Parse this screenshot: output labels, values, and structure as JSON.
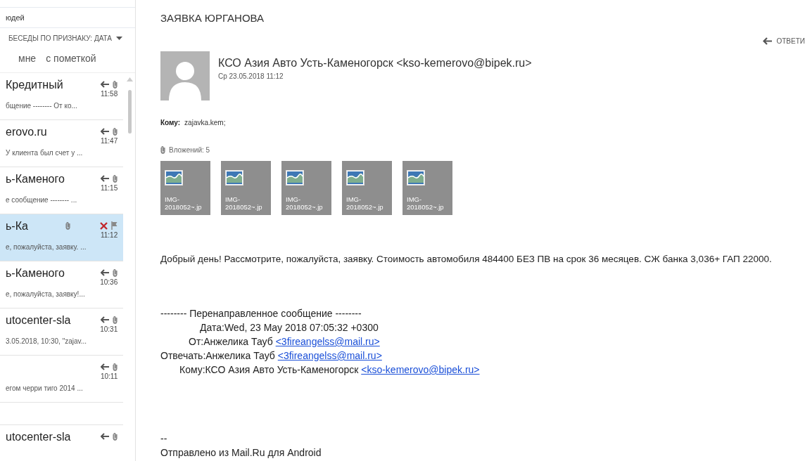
{
  "search": {
    "value": "юдей"
  },
  "sort": {
    "label": "БЕСЕДЫ ПО ПРИЗНАКУ: ДАТА"
  },
  "filters": [
    {
      "label": "мне"
    },
    {
      "label": "с пометкой"
    }
  ],
  "messages": [
    {
      "sender": "Кредитный",
      "preview": "бщение -------- От ко...",
      "time": "11:58",
      "replied": true,
      "attachment": true,
      "selected": false
    },
    {
      "sender": "erovo.ru",
      "preview": "У клиента был счет у ...",
      "time": "11:47",
      "replied": true,
      "attachment": true,
      "selected": false
    },
    {
      "sender": "ь-Каменого",
      "preview": "е сообщение -------- ...",
      "time": "11:15",
      "replied": true,
      "attachment": true,
      "selected": false
    },
    {
      "sender": "ь-Ка",
      "preview": "е, пожалуйста, заявку. ...",
      "time": "11:12",
      "replied": false,
      "attachment": true,
      "selected": true
    },
    {
      "sender": "ь-Каменого",
      "preview": "е, пожалуйста, заявку!...",
      "time": "10:36",
      "replied": true,
      "attachment": true,
      "selected": false
    },
    {
      "sender": "utocenter-sla",
      "preview": "3.05.2018, 10:30, \"zajav...",
      "time": "10:31",
      "replied": true,
      "attachment": true,
      "selected": false
    },
    {
      "preview": "егом черри тиго 2014 ...",
      "time": "10:11",
      "replied": true,
      "attachment": true,
      "selected": false
    },
    {
      "sender": "utocenter-sla",
      "replied": true,
      "attachment": true,
      "selected": false
    }
  ],
  "reading": {
    "subject": "ЗАЯВКА ЮРГАНОВА",
    "reply_label": "ОТВЕТИ",
    "sender": "КСО Азия Авто Усть-Каменогорск <kso-kemerovo@bipek.ru>",
    "date": "Ср 23.05.2018 11:12",
    "to_label": "Кому:",
    "to": "zajavka.kem;",
    "attachments_label": "Вложений: 5",
    "attachments": [
      {
        "name": "IMG-2018052~.jp"
      },
      {
        "name": "IMG-2018052~.jp"
      },
      {
        "name": "IMG-2018052~.jp"
      },
      {
        "name": "IMG-2018052~.jp"
      },
      {
        "name": "IMG-2018052~.jp"
      }
    ],
    "body": "Добрый день! Рассмотрите, пожалуйста, заявку. Стоимость автомобиля 484400 БЕЗ ПВ на срок 36 месяцев. СЖ банка 3,036+ ГАП 22000.",
    "forward_title": "-------- Перенаправленное сообщение --------",
    "forward_lines": [
      {
        "text": "Дата:Wed, 23 May 2018 07:05:32 +0300"
      },
      {
        "text": "От:Анжелика Тауб",
        "link": "<3fireangelss@mail.ru>"
      },
      {
        "text": "Отвечать:Анжелика Тауб",
        "link": "<3fireangelss@mail.ru>"
      },
      {
        "text": "Кому:КСО Азия Авто Усть-Каменогорск",
        "link": "<kso-kemerovo@bipek.ru>"
      }
    ],
    "signature_dash": "--",
    "signature": "Отправлено из Mail.Ru для Android"
  }
}
